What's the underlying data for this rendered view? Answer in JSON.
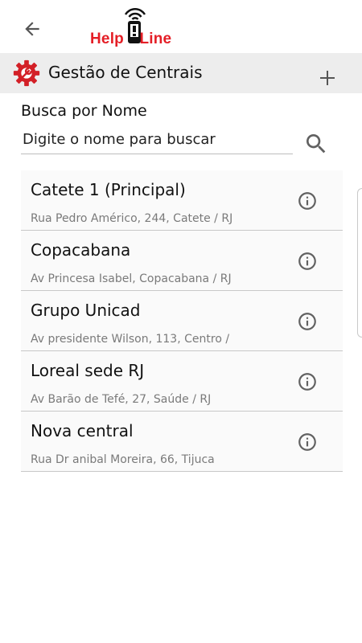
{
  "header": {
    "back_icon": "arrow-left-icon",
    "logo_text": "Help Line"
  },
  "section": {
    "icon": "gear-wrench-icon",
    "title": "Gestão de Centrais",
    "add_icon": "plus-icon"
  },
  "search": {
    "label": "Busca por Nome",
    "placeholder": "Digite o nome para buscar",
    "value": "",
    "icon": "search-icon"
  },
  "centrals": [
    {
      "name": "Catete 1 (Principal)",
      "address": "Rua Pedro Américo, 244, Catete / RJ"
    },
    {
      "name": "Copacabana",
      "address": "Av Princesa Isabel, Copacabana / RJ"
    },
    {
      "name": "Grupo Unicad",
      "address": "Av presidente Wilson, 113, Centro /"
    },
    {
      "name": "Loreal sede RJ",
      "address": "Av Barão de Tefé, 27, Saúde / RJ"
    },
    {
      "name": "Nova central",
      "address": "Rua Dr anibal Moreira, 66, Tijuca"
    }
  ],
  "colors": {
    "brand_red": "#e41e26",
    "header_bg": "#ededed",
    "icon_gray": "#616161"
  }
}
